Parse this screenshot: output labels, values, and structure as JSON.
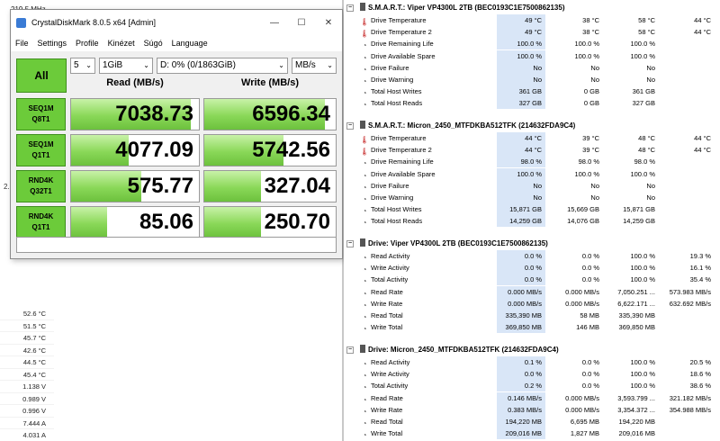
{
  "background_left": {
    "frequency": "219.5 MHz",
    "side_number": "2.",
    "values": [
      "52.6 °C",
      "51.5 °C",
      "45.7 °C",
      "42.6 °C",
      "44.5 °C",
      "45.4 °C",
      "1.138 V",
      "0.989 V",
      "0.996 V",
      "7.444 A",
      "4.031 A"
    ]
  },
  "cdm": {
    "title": "CrystalDiskMark 8.0.5 x64 [Admin]",
    "window_buttons": [
      "—",
      "☐",
      "✕"
    ],
    "menu": [
      "File",
      "Settings",
      "Profile",
      "Kinézet",
      "Súgó",
      "Language"
    ],
    "all_label": "All",
    "count": "5",
    "size": "1GiB",
    "drive": "D: 0% (0/1863GiB)",
    "unit": "MB/s",
    "read_header": "Read (MB/s)",
    "write_header": "Write (MB/s)",
    "tests": [
      {
        "line1": "SEQ1M",
        "line2": "Q8T1",
        "read": "7038.73",
        "write": "6596.34",
        "read_fill": 0.94,
        "write_fill": 0.92
      },
      {
        "line1": "SEQ1M",
        "line2": "Q1T1",
        "read": "4077.09",
        "write": "5742.56",
        "read_fill": 0.45,
        "write_fill": 0.6
      },
      {
        "line1": "RND4K",
        "line2": "Q32T1",
        "read": "575.77",
        "write": "327.04",
        "read_fill": 0.55,
        "write_fill": 0.43
      },
      {
        "line1": "RND4K",
        "line2": "Q1T1",
        "read": "85.06",
        "write": "250.70",
        "read_fill": 0.28,
        "write_fill": 0.43
      }
    ]
  },
  "hwinfo": {
    "sections": [
      {
        "title": "S.M.A.R.T.: Viper VP4300L 2TB (BEC0193C1E7500862135)",
        "rows": [
          {
            "icon": "thermometer-icon",
            "label": "Drive Temperature",
            "c1": "49 °C",
            "c2": "38 °C",
            "c3": "58 °C",
            "c4": "44 °C"
          },
          {
            "icon": "thermometer-icon",
            "label": "Drive Temperature 2",
            "c1": "49 °C",
            "c2": "38 °C",
            "c3": "58 °C",
            "c4": "44 °C"
          },
          {
            "icon": "gauge-icon",
            "label": "Drive Remaining Life",
            "c1": "100.0 %",
            "c2": "100.0 %",
            "c3": "100.0 %",
            "c4": ""
          },
          {
            "icon": "gauge-icon",
            "label": "Drive Available Spare",
            "c1": "100.0 %",
            "c2": "100.0 %",
            "c3": "100.0 %",
            "c4": ""
          },
          {
            "icon": "gauge-icon",
            "label": "Drive Failure",
            "c1": "No",
            "c2": "No",
            "c3": "No",
            "c4": ""
          },
          {
            "icon": "gauge-icon",
            "label": "Drive Warning",
            "c1": "No",
            "c2": "No",
            "c3": "No",
            "c4": ""
          },
          {
            "icon": "gauge-icon",
            "label": "Total Host Writes",
            "c1": "361 GB",
            "c2": "0 GB",
            "c3": "361 GB",
            "c4": ""
          },
          {
            "icon": "gauge-icon",
            "label": "Total Host Reads",
            "c1": "327 GB",
            "c2": "0 GB",
            "c3": "327 GB",
            "c4": ""
          }
        ]
      },
      {
        "title": "S.M.A.R.T.: Micron_2450_MTFDKBA512TFK (214632FDA9C4)",
        "rows": [
          {
            "icon": "thermometer-icon",
            "label": "Drive Temperature",
            "c1": "44 °C",
            "c2": "39 °C",
            "c3": "48 °C",
            "c4": "44 °C"
          },
          {
            "icon": "thermometer-icon",
            "label": "Drive Temperature 2",
            "c1": "44 °C",
            "c2": "39 °C",
            "c3": "48 °C",
            "c4": "44 °C"
          },
          {
            "icon": "gauge-icon",
            "label": "Drive Remaining Life",
            "c1": "98.0 %",
            "c2": "98.0 %",
            "c3": "98.0 %",
            "c4": ""
          },
          {
            "icon": "gauge-icon",
            "label": "Drive Available Spare",
            "c1": "100.0 %",
            "c2": "100.0 %",
            "c3": "100.0 %",
            "c4": ""
          },
          {
            "icon": "gauge-icon",
            "label": "Drive Failure",
            "c1": "No",
            "c2": "No",
            "c3": "No",
            "c4": ""
          },
          {
            "icon": "gauge-icon",
            "label": "Drive Warning",
            "c1": "No",
            "c2": "No",
            "c3": "No",
            "c4": ""
          },
          {
            "icon": "gauge-icon",
            "label": "Total Host Writes",
            "c1": "15,871 GB",
            "c2": "15,669 GB",
            "c3": "15,871 GB",
            "c4": ""
          },
          {
            "icon": "gauge-icon",
            "label": "Total Host Reads",
            "c1": "14,259 GB",
            "c2": "14,076 GB",
            "c3": "14,259 GB",
            "c4": ""
          }
        ]
      },
      {
        "title": "Drive: Viper VP4300L 2TB (BEC0193C1E7500862135)",
        "rows": [
          {
            "icon": "gauge-icon",
            "label": "Read Activity",
            "c1": "0.0 %",
            "c2": "0.0 %",
            "c3": "100.0 %",
            "c4": "19.3 %"
          },
          {
            "icon": "gauge-icon",
            "label": "Write Activity",
            "c1": "0.0 %",
            "c2": "0.0 %",
            "c3": "100.0 %",
            "c4": "16.1 %"
          },
          {
            "icon": "gauge-icon",
            "label": "Total Activity",
            "c1": "0.0 %",
            "c2": "0.0 %",
            "c3": "100.0 %",
            "c4": "35.4 %"
          },
          {
            "icon": "gauge-icon",
            "label": "Read Rate",
            "c1": "0.000 MB/s",
            "c2": "0.000 MB/s",
            "c3": "7,050.251 ...",
            "c4": "573.983 MB/s"
          },
          {
            "icon": "gauge-icon",
            "label": "Write Rate",
            "c1": "0.000 MB/s",
            "c2": "0.000 MB/s",
            "c3": "6,622.171 ...",
            "c4": "632.692 MB/s"
          },
          {
            "icon": "gauge-icon",
            "label": "Read Total",
            "c1": "335,390 MB",
            "c2": "58 MB",
            "c3": "335,390 MB",
            "c4": ""
          },
          {
            "icon": "gauge-icon",
            "label": "Write Total",
            "c1": "369,850 MB",
            "c2": "146 MB",
            "c3": "369,850 MB",
            "c4": ""
          }
        ]
      },
      {
        "title": "Drive: Micron_2450_MTFDKBA512TFK (214632FDA9C4)",
        "rows": [
          {
            "icon": "gauge-icon",
            "label": "Read Activity",
            "c1": "0.1 %",
            "c2": "0.0 %",
            "c3": "100.0 %",
            "c4": "20.5 %"
          },
          {
            "icon": "gauge-icon",
            "label": "Write Activity",
            "c1": "0.0 %",
            "c2": "0.0 %",
            "c3": "100.0 %",
            "c4": "18.6 %"
          },
          {
            "icon": "gauge-icon",
            "label": "Total Activity",
            "c1": "0.2 %",
            "c2": "0.0 %",
            "c3": "100.0 %",
            "c4": "38.6 %"
          },
          {
            "icon": "gauge-icon",
            "label": "Read Rate",
            "c1": "0.146 MB/s",
            "c2": "0.000 MB/s",
            "c3": "3,593.799 ...",
            "c4": "321.182 MB/s"
          },
          {
            "icon": "gauge-icon",
            "label": "Write Rate",
            "c1": "0.383 MB/s",
            "c2": "0.000 MB/s",
            "c3": "3,354.372 ...",
            "c4": "354.988 MB/s"
          },
          {
            "icon": "gauge-icon",
            "label": "Read Total",
            "c1": "194,220 MB",
            "c2": "6,695 MB",
            "c3": "194,220 MB",
            "c4": ""
          },
          {
            "icon": "gauge-icon",
            "label": "Write Total",
            "c1": "209,016 MB",
            "c2": "1,827 MB",
            "c3": "209,016 MB",
            "c4": ""
          }
        ]
      }
    ]
  }
}
